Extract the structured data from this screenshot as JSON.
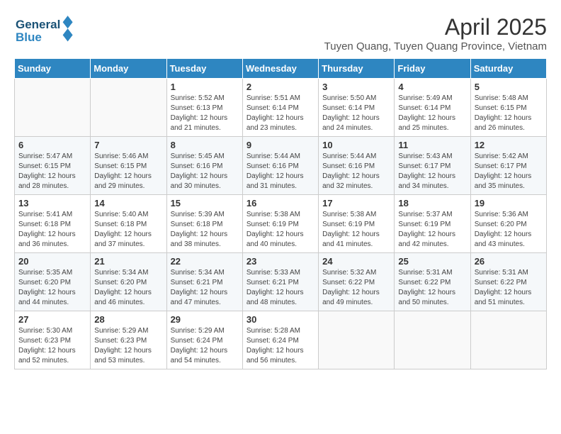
{
  "logo": {
    "line1": "General",
    "line2": "Blue"
  },
  "title": "April 2025",
  "subtitle": "Tuyen Quang, Tuyen Quang Province, Vietnam",
  "days_of_week": [
    "Sunday",
    "Monday",
    "Tuesday",
    "Wednesday",
    "Thursday",
    "Friday",
    "Saturday"
  ],
  "weeks": [
    [
      {
        "day": "",
        "info": ""
      },
      {
        "day": "",
        "info": ""
      },
      {
        "day": "1",
        "info": "Sunrise: 5:52 AM\nSunset: 6:13 PM\nDaylight: 12 hours and 21 minutes."
      },
      {
        "day": "2",
        "info": "Sunrise: 5:51 AM\nSunset: 6:14 PM\nDaylight: 12 hours and 23 minutes."
      },
      {
        "day": "3",
        "info": "Sunrise: 5:50 AM\nSunset: 6:14 PM\nDaylight: 12 hours and 24 minutes."
      },
      {
        "day": "4",
        "info": "Sunrise: 5:49 AM\nSunset: 6:14 PM\nDaylight: 12 hours and 25 minutes."
      },
      {
        "day": "5",
        "info": "Sunrise: 5:48 AM\nSunset: 6:15 PM\nDaylight: 12 hours and 26 minutes."
      }
    ],
    [
      {
        "day": "6",
        "info": "Sunrise: 5:47 AM\nSunset: 6:15 PM\nDaylight: 12 hours and 28 minutes."
      },
      {
        "day": "7",
        "info": "Sunrise: 5:46 AM\nSunset: 6:15 PM\nDaylight: 12 hours and 29 minutes."
      },
      {
        "day": "8",
        "info": "Sunrise: 5:45 AM\nSunset: 6:16 PM\nDaylight: 12 hours and 30 minutes."
      },
      {
        "day": "9",
        "info": "Sunrise: 5:44 AM\nSunset: 6:16 PM\nDaylight: 12 hours and 31 minutes."
      },
      {
        "day": "10",
        "info": "Sunrise: 5:44 AM\nSunset: 6:16 PM\nDaylight: 12 hours and 32 minutes."
      },
      {
        "day": "11",
        "info": "Sunrise: 5:43 AM\nSunset: 6:17 PM\nDaylight: 12 hours and 34 minutes."
      },
      {
        "day": "12",
        "info": "Sunrise: 5:42 AM\nSunset: 6:17 PM\nDaylight: 12 hours and 35 minutes."
      }
    ],
    [
      {
        "day": "13",
        "info": "Sunrise: 5:41 AM\nSunset: 6:18 PM\nDaylight: 12 hours and 36 minutes."
      },
      {
        "day": "14",
        "info": "Sunrise: 5:40 AM\nSunset: 6:18 PM\nDaylight: 12 hours and 37 minutes."
      },
      {
        "day": "15",
        "info": "Sunrise: 5:39 AM\nSunset: 6:18 PM\nDaylight: 12 hours and 38 minutes."
      },
      {
        "day": "16",
        "info": "Sunrise: 5:38 AM\nSunset: 6:19 PM\nDaylight: 12 hours and 40 minutes."
      },
      {
        "day": "17",
        "info": "Sunrise: 5:38 AM\nSunset: 6:19 PM\nDaylight: 12 hours and 41 minutes."
      },
      {
        "day": "18",
        "info": "Sunrise: 5:37 AM\nSunset: 6:19 PM\nDaylight: 12 hours and 42 minutes."
      },
      {
        "day": "19",
        "info": "Sunrise: 5:36 AM\nSunset: 6:20 PM\nDaylight: 12 hours and 43 minutes."
      }
    ],
    [
      {
        "day": "20",
        "info": "Sunrise: 5:35 AM\nSunset: 6:20 PM\nDaylight: 12 hours and 44 minutes."
      },
      {
        "day": "21",
        "info": "Sunrise: 5:34 AM\nSunset: 6:20 PM\nDaylight: 12 hours and 46 minutes."
      },
      {
        "day": "22",
        "info": "Sunrise: 5:34 AM\nSunset: 6:21 PM\nDaylight: 12 hours and 47 minutes."
      },
      {
        "day": "23",
        "info": "Sunrise: 5:33 AM\nSunset: 6:21 PM\nDaylight: 12 hours and 48 minutes."
      },
      {
        "day": "24",
        "info": "Sunrise: 5:32 AM\nSunset: 6:22 PM\nDaylight: 12 hours and 49 minutes."
      },
      {
        "day": "25",
        "info": "Sunrise: 5:31 AM\nSunset: 6:22 PM\nDaylight: 12 hours and 50 minutes."
      },
      {
        "day": "26",
        "info": "Sunrise: 5:31 AM\nSunset: 6:22 PM\nDaylight: 12 hours and 51 minutes."
      }
    ],
    [
      {
        "day": "27",
        "info": "Sunrise: 5:30 AM\nSunset: 6:23 PM\nDaylight: 12 hours and 52 minutes."
      },
      {
        "day": "28",
        "info": "Sunrise: 5:29 AM\nSunset: 6:23 PM\nDaylight: 12 hours and 53 minutes."
      },
      {
        "day": "29",
        "info": "Sunrise: 5:29 AM\nSunset: 6:24 PM\nDaylight: 12 hours and 54 minutes."
      },
      {
        "day": "30",
        "info": "Sunrise: 5:28 AM\nSunset: 6:24 PM\nDaylight: 12 hours and 56 minutes."
      },
      {
        "day": "",
        "info": ""
      },
      {
        "day": "",
        "info": ""
      },
      {
        "day": "",
        "info": ""
      }
    ]
  ]
}
